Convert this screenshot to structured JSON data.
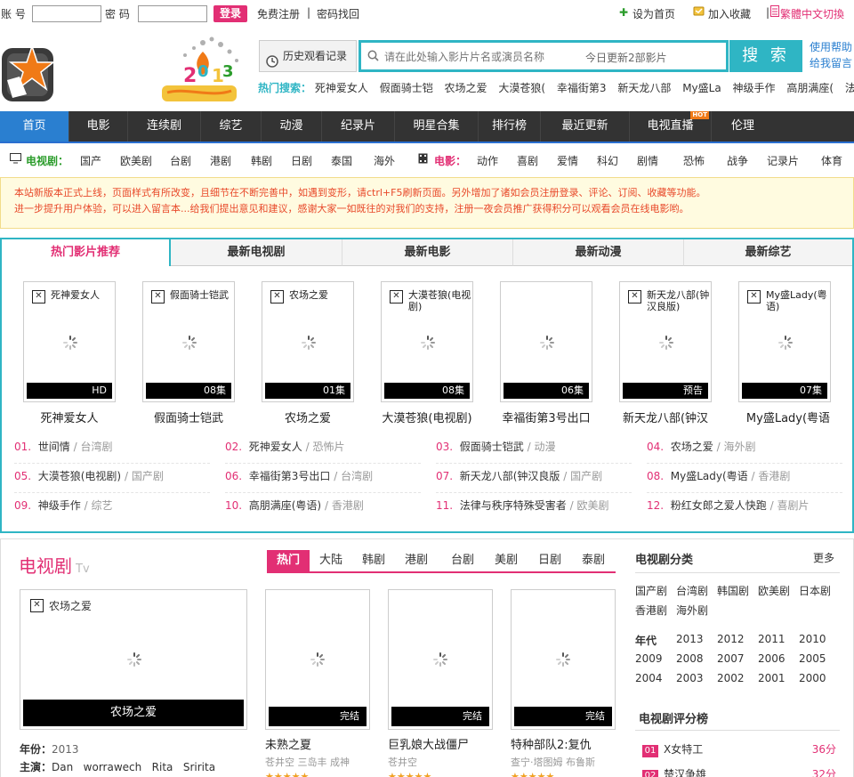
{
  "colors": {
    "accent": "#e22f74",
    "teal": "#2fb5c4",
    "nav_bg": "#333333",
    "nav_active": "#2a7fd0"
  },
  "topbar": {
    "account_label": "账 号",
    "password_label": "密 码",
    "login": "登录",
    "register": "免费注册",
    "recover": "密码找回",
    "set_home": "设为首页",
    "add_fav": "加入收藏",
    "lang_switch": "繁體中文切換"
  },
  "header": {
    "history": "历史观看记录",
    "search_placeholder": "请在此处输入影片片名或演员名称",
    "search_sub": "今日更新2部影片",
    "search_btn": "搜 索",
    "help1": "使用帮助",
    "help2": "给我留言",
    "hot_label": "热门搜索：",
    "hot": [
      "死神爱女人",
      "假面骑士铠",
      "农场之爱",
      "大漠苍狼(",
      "幸福街第3",
      "新天龙八部",
      "My盛La",
      "神级手作",
      "高朋满座(",
      "法律与"
    ]
  },
  "nav": {
    "items": [
      "首页",
      "电影",
      "连续剧",
      "综艺",
      "动漫",
      "纪录片",
      "明星合集",
      "排行榜",
      "最近更新",
      "电视直播",
      "伦理"
    ],
    "hot_badge": "HOT"
  },
  "subnav": {
    "tv_label": "电视剧：",
    "tv": [
      "国产",
      "欧美剧",
      "台剧",
      "港剧",
      "韩剧",
      "日剧",
      "泰国",
      "海外"
    ],
    "movie_label": "电影：",
    "movie": [
      "动作",
      "喜剧",
      "爱情",
      "科幻",
      "剧情",
      "恐怖",
      "战争",
      "记录片",
      "体育"
    ]
  },
  "notice": {
    "line1": "本站新版本正式上线，页面样式有所改变，且细节在不断完善中，如遇到变形，请ctrl+F5刷新页面。另外增加了诸如会员注册登录、评论、订阅、收藏等功能。",
    "line2": "进一步提升用户体验，可以进入留言本...给我们提出意见和建议，感谢大家一如既往的对我们的支持，注册一夜会员推广获得积分可以观看会员在线电影哟。"
  },
  "hot_panel": {
    "tabs": [
      "热门影片推荐",
      "最新电视剧",
      "最新电影",
      "最新动漫",
      "最新综艺"
    ],
    "cards": [
      {
        "alt": "死神爱女人",
        "badge": "HD",
        "title": "死神爱女人"
      },
      {
        "alt": "假面骑士铠武",
        "badge": "08集",
        "title": "假面骑士铠武"
      },
      {
        "alt": "农场之爱",
        "badge": "01集",
        "title": "农场之爱"
      },
      {
        "alt": "大漠苍狼(电视剧)",
        "badge": "08集",
        "title": "大漠苍狼(电视剧)"
      },
      {
        "alt": "",
        "badge": "06集",
        "title": "幸福街第3号出口"
      },
      {
        "alt": "新天龙八部(钟汉良版)",
        "badge": "预告",
        "title": "新天龙八部(钟汉"
      },
      {
        "alt": "My盛Lady(粤语)",
        "badge": "07集",
        "title": "My盛Lady(粤语"
      }
    ],
    "ranks": [
      {
        "n": "01.",
        "t": "世间情",
        "c": "台湾剧"
      },
      {
        "n": "02.",
        "t": "死神爱女人",
        "c": "恐怖片"
      },
      {
        "n": "03.",
        "t": "假面骑士铠武",
        "c": "动漫"
      },
      {
        "n": "04.",
        "t": "农场之爱",
        "c": "海外剧"
      },
      {
        "n": "05.",
        "t": "大漠苍狼(电视剧)",
        "c": "国产剧"
      },
      {
        "n": "06.",
        "t": "幸福街第3号出口",
        "c": "台湾剧"
      },
      {
        "n": "07.",
        "t": "新天龙八部(钟汉良版",
        "c": "国产剧"
      },
      {
        "n": "08.",
        "t": "My盛Lady(粤语",
        "c": "香港剧"
      },
      {
        "n": "09.",
        "t": "神级手作",
        "c": "综艺"
      },
      {
        "n": "10.",
        "t": "高朋满座(粤语)",
        "c": "香港剧"
      },
      {
        "n": "11.",
        "t": "法律与秩序特殊受害者",
        "c": "欧美剧"
      },
      {
        "n": "12.",
        "t": "粉红女郎之爱人快跑",
        "c": "喜剧片"
      }
    ]
  },
  "tv": {
    "title": "电视剧",
    "title_en": "Tv",
    "tabs": [
      "热门",
      "大陆",
      "韩剧",
      "港剧",
      "台剧",
      "美剧",
      "日剧",
      "泰剧"
    ],
    "feature": {
      "alt": "农场之爱",
      "bar": "农场之爱",
      "year_label": "年份：",
      "year": "2013",
      "cast_label": "主演：",
      "cast": "Dan   worrawech   Rita   Sririta"
    },
    "cards": [
      {
        "badge": "完结",
        "name": "未熟之夏",
        "cast": "苍井空  三岛丰  成神"
      },
      {
        "badge": "完结",
        "name": "巨乳娘大战僵尸",
        "cast": "苍井空"
      },
      {
        "badge": "完结",
        "name": "特种部队2:复仇",
        "cast": "查宁·塔图姆  布鲁斯"
      }
    ],
    "stars": "★★★★★"
  },
  "side": {
    "cat_head": "电视剧分类",
    "more": "更多",
    "cats": [
      "国产剧",
      "台湾剧",
      "韩国剧",
      "欧美剧",
      "日本剧",
      "香港剧",
      "海外剧"
    ],
    "year_label": "年代",
    "years": [
      "2013",
      "2012",
      "2011",
      "2010",
      "2009",
      "2008",
      "2007",
      "2006",
      "2005",
      "2004",
      "2003",
      "2002",
      "2001",
      "2000"
    ],
    "rank_head": "电视剧评分榜",
    "ranks": [
      {
        "n": "01",
        "t": "X女特工",
        "s": "36分"
      },
      {
        "n": "02",
        "t": "楚汉争雄",
        "s": "32分"
      }
    ]
  }
}
